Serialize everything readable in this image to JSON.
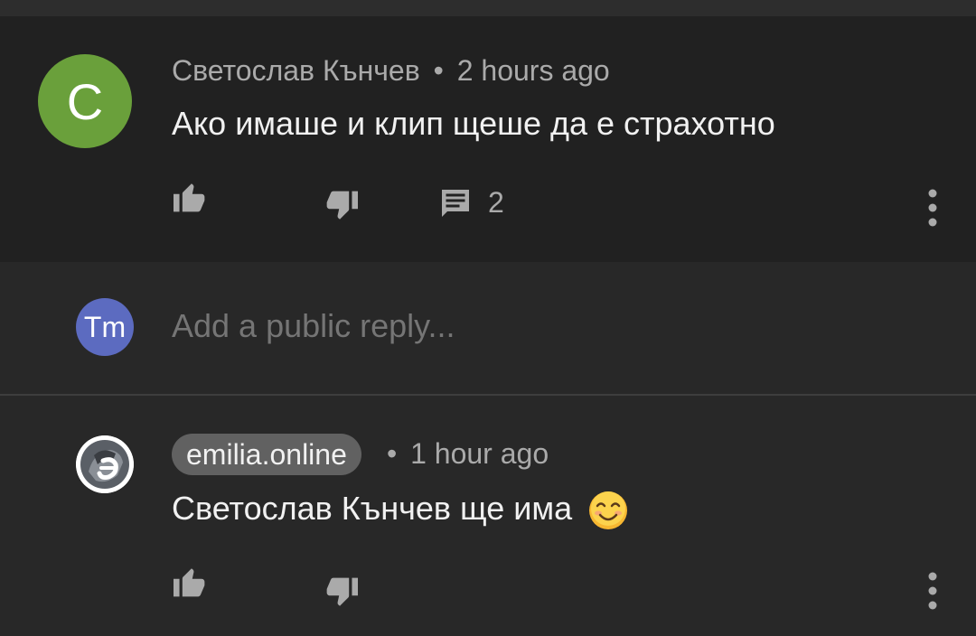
{
  "parent_comment": {
    "avatar_letter": "С",
    "avatar_color": "#6aa03b",
    "author": "Светослав Кънчев",
    "separator": "•",
    "time": "2 hours ago",
    "text": "Ако имаше и клип щеше да е страхотно",
    "reply_count": "2"
  },
  "reply_box": {
    "avatar_text": "Tm",
    "avatar_color": "#5c6bc0",
    "placeholder": "Add a public reply..."
  },
  "reply_comment": {
    "author": "emilia.online",
    "separator": "•",
    "time": "1 hour ago",
    "text": "Светослав Кънчев ще има",
    "emoji": "smiling-face-icon"
  },
  "icons": {
    "like": "thumb-up-icon",
    "dislike": "thumb-down-icon",
    "reply": "comment-icon",
    "more": "more-vert-icon"
  }
}
